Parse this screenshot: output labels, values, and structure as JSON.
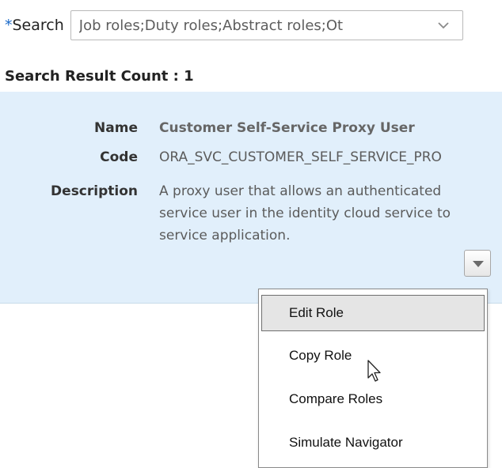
{
  "search": {
    "required_marker": "*",
    "label": "Search",
    "value": "Job roles;Duty roles;Abstract roles;Ot"
  },
  "results": {
    "count_label": "Search Result Count : 1"
  },
  "role": {
    "name_label": "Name",
    "name": "Customer Self-Service Proxy User",
    "code_label": "Code",
    "code": "ORA_SVC_CUSTOMER_SELF_SERVICE_PRO",
    "description_label": "Description",
    "description_lines": [
      "A proxy user that allows an authenticated",
      "service user in the identity cloud service to",
      "service application."
    ]
  },
  "context_menu": {
    "items": [
      "Edit Role",
      "Copy Role",
      "Compare Roles",
      "Simulate Navigator"
    ],
    "selected": "Edit Role"
  },
  "icons": {
    "dropdown": "chevron-down-icon",
    "actions": "triangle-down-icon",
    "cursor": "mouse-pointer-icon"
  }
}
